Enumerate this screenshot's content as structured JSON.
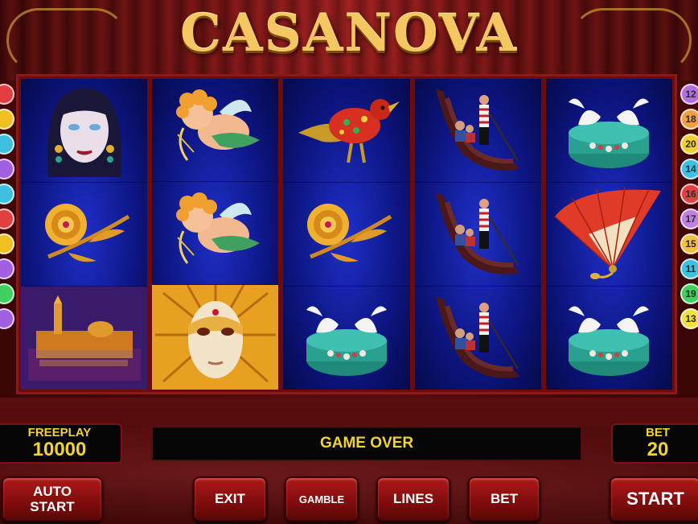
{
  "game": {
    "title": "CASANOVA"
  },
  "colors": {
    "accent_text": "#f4d428",
    "button_red": "#b01818",
    "reel_blue": "#1f2fc8",
    "background": "#6b0b0b"
  },
  "reels": [
    [
      "woman-portrait",
      "golden-rose",
      "venice-night-city"
    ],
    [
      "cupid",
      "cupid",
      "venetian-mask"
    ],
    [
      "jeweled-bird",
      "golden-rose",
      "doves-on-jewel-box"
    ],
    [
      "gondola",
      "gondola",
      "gondola"
    ],
    [
      "doves-on-jewel-box",
      "red-fan",
      "doves-on-jewel-box"
    ]
  ],
  "line_markers": {
    "left_colors": [
      "#e04040",
      "#f0c020",
      "#40c0e0",
      "#a060e0",
      "#40c0e0",
      "#e04040",
      "#f0c020",
      "#a060e0",
      "#40d060",
      "#a060e0"
    ],
    "right": [
      {
        "label": "12",
        "color": "#b070e0"
      },
      {
        "label": "18",
        "color": "#f0a040"
      },
      {
        "label": "20",
        "color": "#f0d030"
      },
      {
        "label": "14",
        "color": "#40c0e0"
      },
      {
        "label": "16",
        "color": "#e04040"
      },
      {
        "label": "17",
        "color": "#c080e0"
      },
      {
        "label": "15",
        "color": "#f0c040"
      },
      {
        "label": "11",
        "color": "#40c0e0"
      },
      {
        "label": "19",
        "color": "#40d060"
      },
      {
        "label": "13",
        "color": "#f0e040"
      }
    ]
  },
  "freeplay": {
    "label": "FREEPLAY",
    "value": "10000"
  },
  "bet": {
    "label": "BET",
    "value": "20"
  },
  "message": "GAME OVER",
  "buttons": {
    "auto_start_line1": "AUTO",
    "auto_start_line2": "START",
    "exit": "EXIT",
    "gamble": "GAMBLE",
    "lines": "LINES",
    "bet": "BET",
    "start": "START"
  }
}
